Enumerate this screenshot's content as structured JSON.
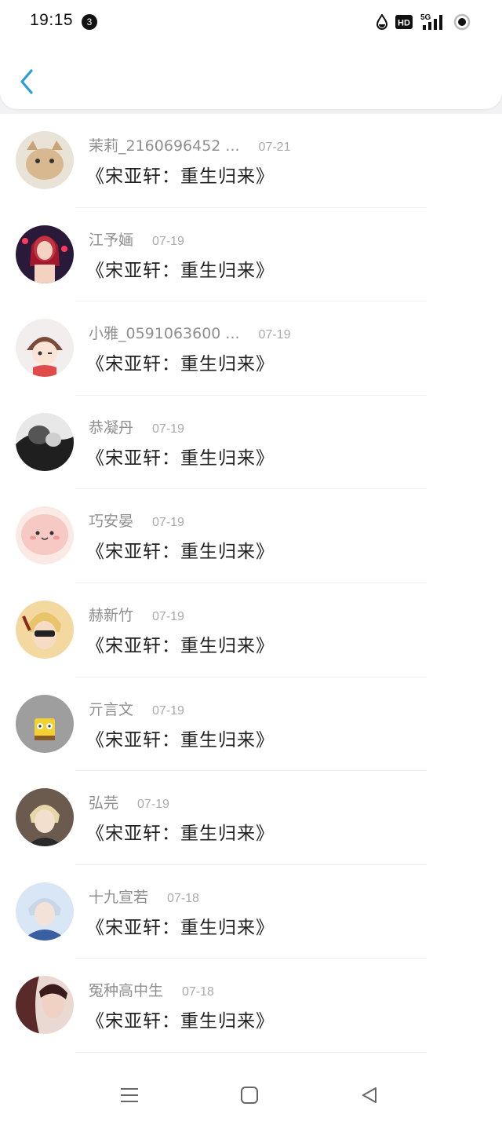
{
  "status_bar": {
    "time": "19:15",
    "notification_count": "3",
    "hd_label": "HD",
    "network_label": "5G"
  },
  "list": {
    "items": [
      {
        "name": "茉莉_2160696452 ...",
        "date": "07-21",
        "title": "《宋亚轩：重生归来》",
        "avatar_color": "#d8b98f"
      },
      {
        "name": "江予婳",
        "date": "07-19",
        "title": "《宋亚轩：重生归来》",
        "avatar_color": "#7a2a3a"
      },
      {
        "name": "小雅_0591063600 ...",
        "date": "07-19",
        "title": "《宋亚轩：重生归来》",
        "avatar_color": "#f1d6d0"
      },
      {
        "name": "恭凝丹",
        "date": "07-19",
        "title": "《宋亚轩：重生归来》",
        "avatar_color": "#3a3a3a"
      },
      {
        "name": "巧安晏",
        "date": "07-19",
        "title": "《宋亚轩：重生归来》",
        "avatar_color": "#f7c9c4"
      },
      {
        "name": "赫新竹",
        "date": "07-19",
        "title": "《宋亚轩：重生归来》",
        "avatar_color": "#f3d9a0"
      },
      {
        "name": "亓言文",
        "date": "07-19",
        "title": "《宋亚轩：重生归来》",
        "avatar_color": "#9e9e9e"
      },
      {
        "name": "弘芫",
        "date": "07-19",
        "title": "《宋亚轩：重生归来》",
        "avatar_color": "#6b5a4e"
      },
      {
        "name": "十九宣若",
        "date": "07-18",
        "title": "《宋亚轩：重生归来》",
        "avatar_color": "#4a7ab8"
      },
      {
        "name": "冤种高中生",
        "date": "07-18",
        "title": "《宋亚轩：重生归来》",
        "avatar_color": "#8a4a4a"
      }
    ]
  },
  "colors": {
    "accent": "#2a9bdc",
    "title_text": "#222222",
    "name_text": "#8f8f8f",
    "date_text": "#aaaaaa"
  },
  "icons": {
    "back": "chevron-left-icon",
    "menu": "menu-icon",
    "home": "home-square-icon",
    "nav_back": "triangle-back-icon"
  }
}
